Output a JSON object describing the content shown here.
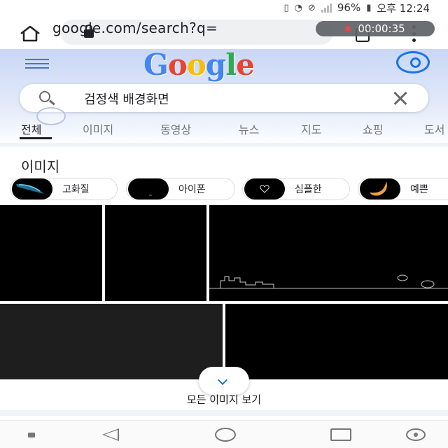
{
  "status_bar": {
    "battery_percent": "96%",
    "time": "오후 12:24",
    "icons": [
      "vibrate-icon",
      "wifi-icon",
      "no-sim-icon",
      "signal-icon",
      "battery-icon"
    ]
  },
  "browser": {
    "url": "google.com/search?q=",
    "recording_time": "00:00:35",
    "icons": [
      "home-icon",
      "lock-icon",
      "tabs-icon",
      "menu-dots-icon"
    ]
  },
  "google": {
    "logo_letters": [
      "G",
      "o",
      "o",
      "g",
      "l",
      "e"
    ],
    "logo_colors": [
      "#4285f4",
      "#ea4335",
      "#fbbc05",
      "#4285f4",
      "#34a853",
      "#ea4335"
    ]
  },
  "search": {
    "query": "검정색 배경화면"
  },
  "tabs": [
    {
      "label": "전체",
      "active": true
    },
    {
      "label": "이미지",
      "active": false
    },
    {
      "label": "동영상",
      "active": false
    },
    {
      "label": "뉴스",
      "active": false
    },
    {
      "label": "지도",
      "active": false
    },
    {
      "label": "쇼핑",
      "active": false
    },
    {
      "label": "도서",
      "active": false
    }
  ],
  "images_section": {
    "title": "이미지",
    "chips": [
      {
        "label": "고화질"
      },
      {
        "label": "아이폰"
      },
      {
        "label": "심플한"
      },
      {
        "label": "예쁜"
      }
    ],
    "more_label": "모든 이미지 보기"
  },
  "nav_bar": {
    "icons": [
      "pin-icon",
      "back-icon",
      "home-icon",
      "recent-apps-icon",
      "assist-icon"
    ]
  },
  "colors": {
    "accent_blue": "#1a73e8",
    "header_band": "#c9d7f5",
    "record_dot": "#e53935"
  }
}
